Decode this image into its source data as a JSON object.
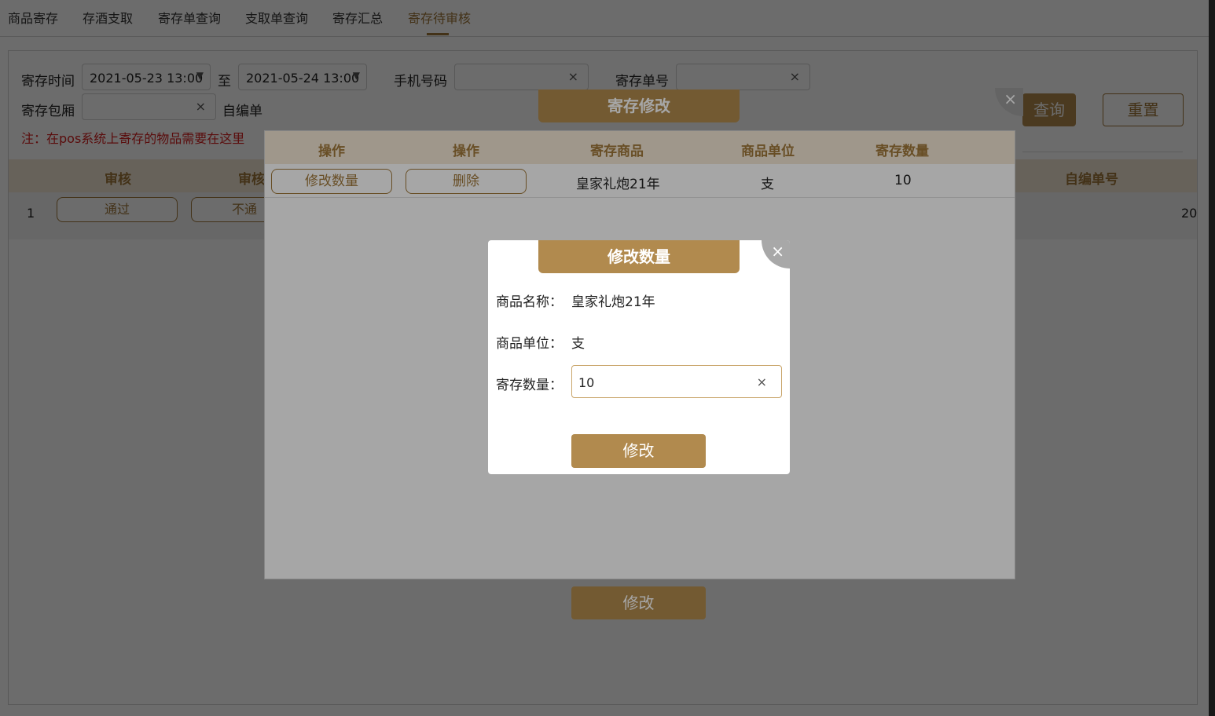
{
  "tabs": [
    {
      "label": "商品寄存"
    },
    {
      "label": "存酒支取"
    },
    {
      "label": "寄存单查询"
    },
    {
      "label": "支取单查询"
    },
    {
      "label": "寄存汇总"
    },
    {
      "label": "寄存待审核"
    }
  ],
  "filters": {
    "time_label": "寄存时间",
    "time_start": "2021-05-23 13:00",
    "to_label": "至",
    "time_end": "2021-05-24 13:00",
    "phone_label": "手机号码",
    "order_no_label": "寄存单号",
    "room_label": "寄存包厢",
    "self_no_label_partial": "自编单",
    "clear_icon": "×",
    "dropdown_icon": "▼"
  },
  "note_partial": "注：在pos系统上寄存的物品需要在这里",
  "buttons": {
    "query_partial": "查询",
    "reset": "重置"
  },
  "table": {
    "headers": {
      "approve": "审核",
      "approve2_partial": "审核",
      "self_no": "自编单号"
    },
    "row": {
      "index": "1",
      "pass": "通过",
      "reject_partial": "不通",
      "trailing_partial": "20"
    }
  },
  "edit_modal": {
    "title": "寄存修改",
    "close_icon": "×",
    "headers": [
      "操作",
      "操作",
      "寄存商品",
      "商品单位",
      "寄存数量"
    ],
    "row": {
      "modify_qty": "修改数量",
      "delete": "删除",
      "product": "皇家礼炮21年",
      "unit": "支",
      "qty": "10"
    },
    "submit": "修改"
  },
  "qty_dialog": {
    "title": "修改数量",
    "close_icon": "×",
    "name_label": "商品名称：",
    "name_value": "皇家礼炮21年",
    "unit_label": "商品单位：",
    "unit_value": "支",
    "qty_label": "寄存数量：",
    "qty_value": "10",
    "clear_icon": "×",
    "submit": "修改"
  }
}
